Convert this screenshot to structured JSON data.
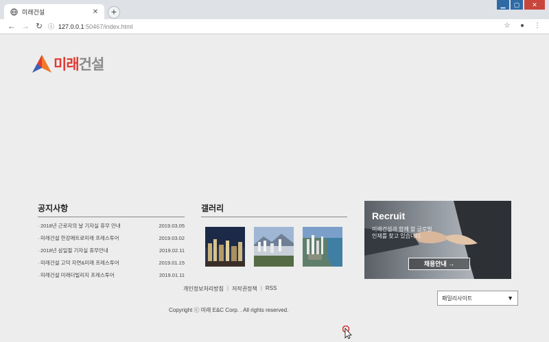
{
  "browser": {
    "tab_title": "미래건설",
    "tab_close": "✕",
    "new_tab": "+",
    "url_host": "127.0.0.1",
    "url_path": ":50467/index.html",
    "info_glyph": "ⓘ"
  },
  "site": {
    "logo_text_red": "미래",
    "logo_text_gray": "건설"
  },
  "notice": {
    "title": "공지사항",
    "items": [
      {
        "text": "2018년 근로자의 날 기자실 휴무 안내",
        "date": "2019.03.05"
      },
      {
        "text": "미래건설 한강메트로미래 프레스투어",
        "date": "2019.03.02"
      },
      {
        "text": "2018년 삼일절 기자실 휴무안내",
        "date": "2019.02.11"
      },
      {
        "text": "미래건설 고덕 자연&미래 프레스투어",
        "date": "2019.01.15"
      },
      {
        "text": "미래건설 미래더빌리지 프레스투어",
        "date": "2019.01.11"
      }
    ]
  },
  "gallery": {
    "title": "갤러리"
  },
  "recruit": {
    "title": "Recruit",
    "desc": "미래건설과 함께 할 글로벌 인재를 찾고 있습니다.",
    "button": "채용안내 →"
  },
  "footer": {
    "links": [
      "개인정보처리방침",
      "저작권정책",
      "RSS"
    ],
    "copyright": "Copyright ⓒ 미래 E&C Corp. . All rights reserved.",
    "family_select": "패밀리사이트",
    "family_arrow": "▼"
  }
}
